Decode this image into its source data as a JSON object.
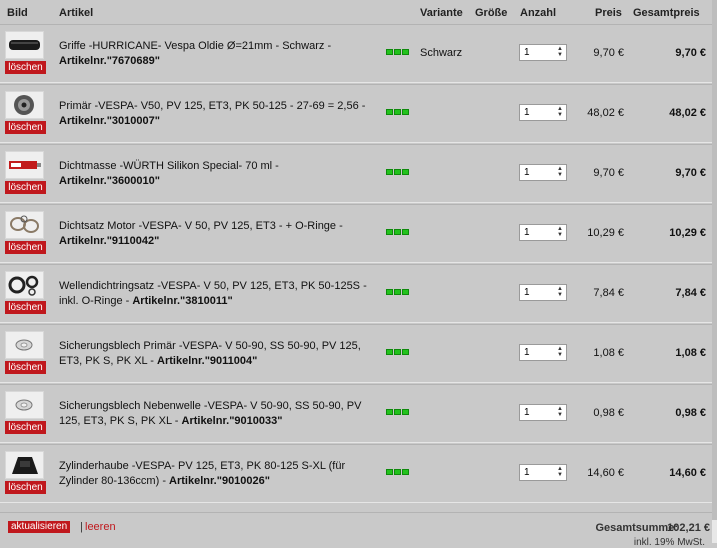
{
  "header": {
    "image": "Bild",
    "article": "Artikel",
    "variant": "Variante",
    "size": "Größe",
    "quantity": "Anzahl",
    "price": "Preis",
    "total": "Gesamtpreis"
  },
  "delete_label": "löschen",
  "stock_color": "#22c21c",
  "accent_color": "#c0181d",
  "items": [
    {
      "desc": "Griffe -HURRICANE- Vespa Oldie Ø=21mm - Schwarz -",
      "artno_label": "Artikelnr.",
      "artno": "\"7670689\"",
      "variant": "Schwarz",
      "qty": "1",
      "price": "9,70 €",
      "total": "9,70 €",
      "thumb": "grips-icon"
    },
    {
      "desc": "Primär -VESPA- V50, PV 125, ET3, PK 50-125 - 27-69 = 2,56 -",
      "artno_label": "Artikelnr.",
      "artno": "\"3010007\"",
      "variant": "",
      "qty": "1",
      "price": "48,02 €",
      "total": "48,02 €",
      "thumb": "gear-icon"
    },
    {
      "desc": "Dichtmasse -WÜRTH Silikon Special- 70 ml -",
      "artno_label": "Artikelnr.",
      "artno": "\"3600010\"",
      "variant": "",
      "qty": "1",
      "price": "9,70 €",
      "total": "9,70 €",
      "thumb": "tube-icon"
    },
    {
      "desc": "Dichtsatz Motor -VESPA- V 50, PV 125, ET3 - + O-Ringe -",
      "artno_label": "Artikelnr.",
      "artno": "\"9110042\"",
      "variant": "",
      "qty": "1",
      "price": "10,29 €",
      "total": "10,29 €",
      "thumb": "gasket-icon"
    },
    {
      "desc": "Wellendichtringsatz -VESPA- V 50, PV 125, ET3, PK 50-125S - inkl. O-Ringe -",
      "artno_label": "Artikelnr.",
      "artno": "\"3810011\"",
      "variant": "",
      "qty": "1",
      "price": "7,84 €",
      "total": "7,84 €",
      "thumb": "seal-icon"
    },
    {
      "desc": "Sicherungsblech Primär -VESPA- V 50-90, SS 50-90, PV 125, ET3, PK S, PK XL -",
      "artno_label": "Artikelnr.",
      "artno": "\"9011004\"",
      "variant": "",
      "qty": "1",
      "price": "1,08 €",
      "total": "1,08 €",
      "thumb": "washer-icon"
    },
    {
      "desc": "Sicherungsblech Nebenwelle -VESPA- V 50-90, SS 50-90, PV 125, ET3, PK S, PK XL -",
      "artno_label": "Artikelnr.",
      "artno": "\"9010033\"",
      "variant": "",
      "qty": "1",
      "price": "0,98 €",
      "total": "0,98 €",
      "thumb": "washer-icon"
    },
    {
      "desc": "Zylinderhaube -VESPA- PV 125, ET3, PK 80-125 S-XL (für Zylinder 80-136ccm) -",
      "artno_label": "Artikelnr.",
      "artno": "\"9010026\"",
      "variant": "",
      "qty": "1",
      "price": "14,60 €",
      "total": "14,60 €",
      "thumb": "cowl-icon"
    }
  ],
  "footer": {
    "update": "aktualisieren",
    "separator": "|",
    "clear": "leeren",
    "sum_label": "Gesamtsumme:",
    "sum_value": "102,21 €",
    "vat_note": "inkl. 19% MwSt."
  }
}
